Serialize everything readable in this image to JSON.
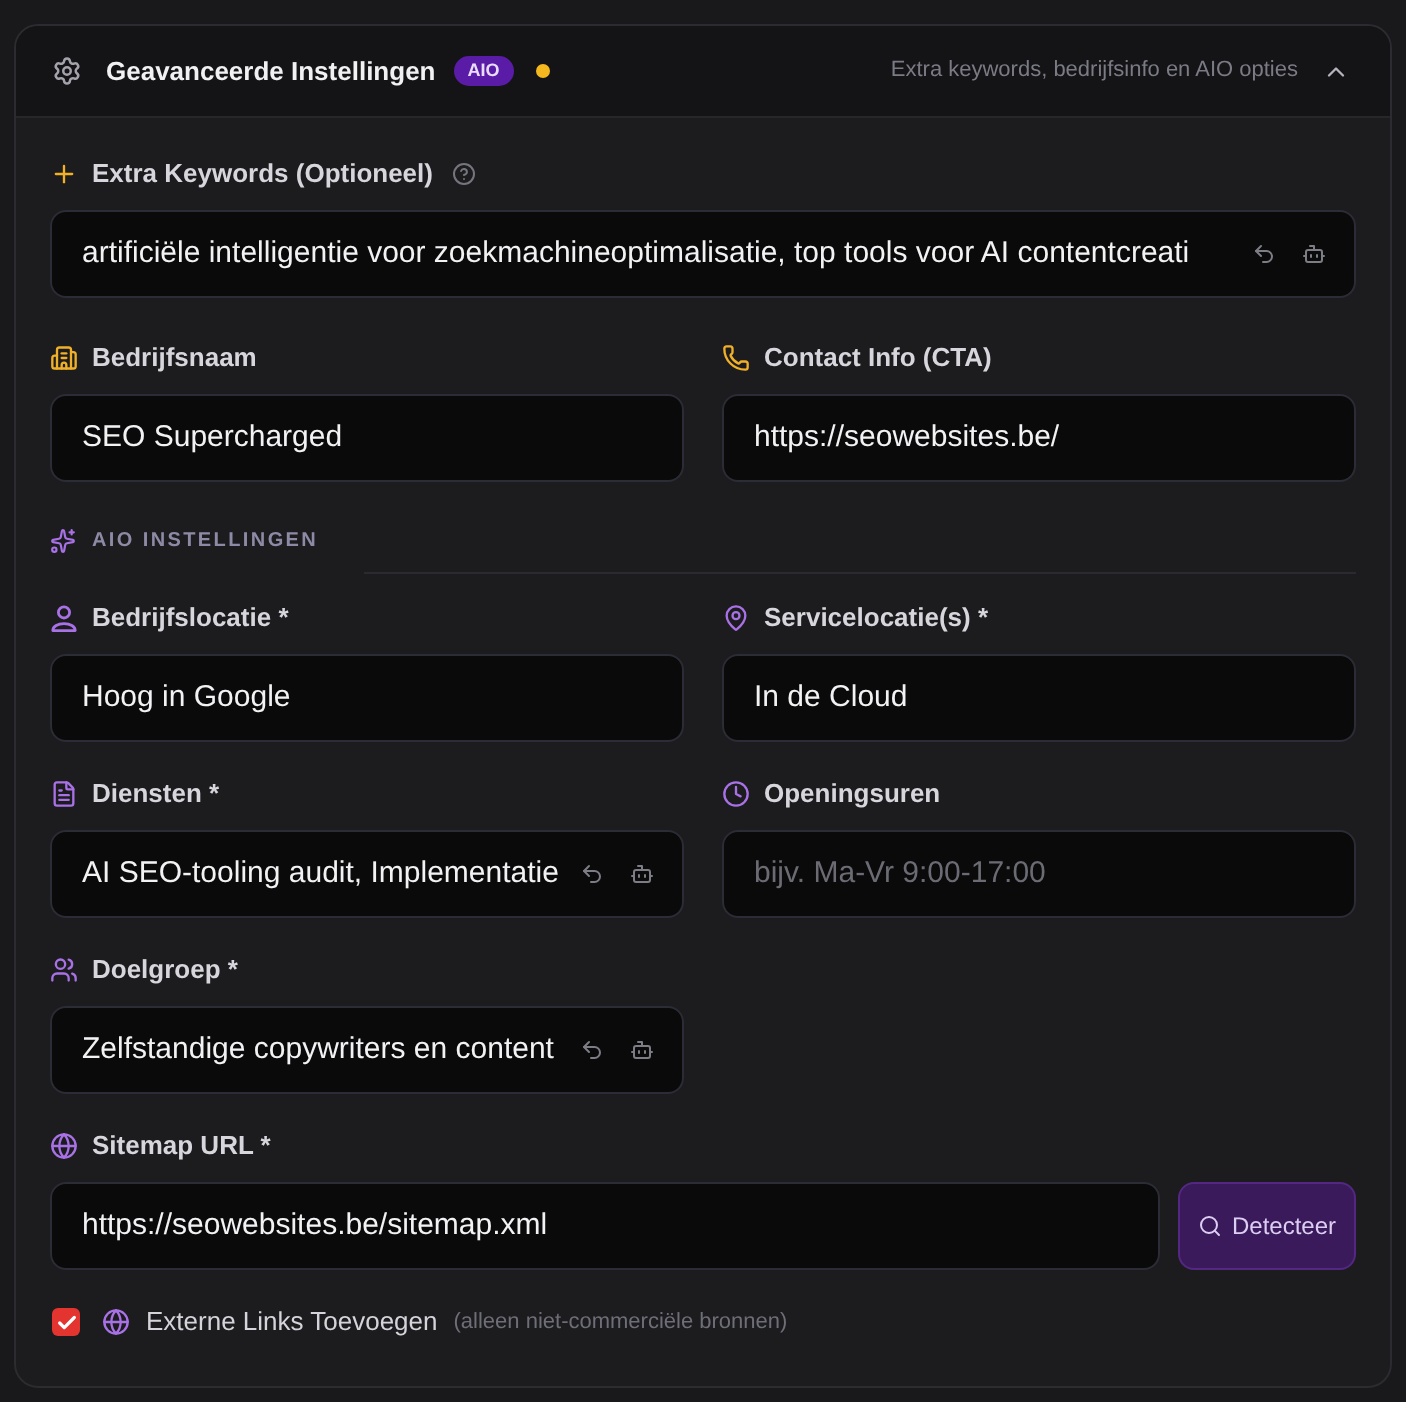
{
  "header": {
    "title": "Geavanceerde Instellingen",
    "badge": "AIO",
    "has_changes": true,
    "subtitle": "Extra keywords, bedrijfsinfo en AIO opties",
    "expanded": true
  },
  "general": {
    "keywords": {
      "label": "Extra Keywords (Optioneel)",
      "value": "artificiële intelligentie voor zoekmachineoptimalisatie, top tools voor AI contentcreati",
      "ai_actions": true
    },
    "company_name": {
      "label": "Bedrijfsnaam",
      "value": "SEO Supercharged",
      "ai_actions": false
    },
    "contact": {
      "label": "Contact Info (CTA)",
      "value": "https://seowebsites.be/",
      "ai_actions": false
    }
  },
  "aio": {
    "heading": "AIO INSTELLINGEN",
    "company_location": {
      "label": "Bedrijfslocatie *",
      "value": "Hoog in Google",
      "ai_actions": false
    },
    "service_locations": {
      "label": "Servicelocatie(s) *",
      "value": "In de Cloud",
      "ai_actions": false
    },
    "services": {
      "label": "Diensten *",
      "value": "AI SEO-tooling audit, Implementatie",
      "ai_actions": true
    },
    "opening_hours": {
      "label": "Openingsuren",
      "placeholder": "bijv. Ma-Vr 9:00-17:00",
      "ai_actions": false
    },
    "audience": {
      "label": "Doelgroep *",
      "value": "Zelfstandige copywriters en content",
      "ai_actions": true
    },
    "sitemap": {
      "label": "Sitemap URL *",
      "value": "https://seowebsites.be/sitemap.xml",
      "button": "Detecteer",
      "ai_actions": false
    }
  },
  "external_links": {
    "label": "Externe Links Toevoegen",
    "hint": "(alleen niet-commerciële bronnen)",
    "checked": true
  }
}
